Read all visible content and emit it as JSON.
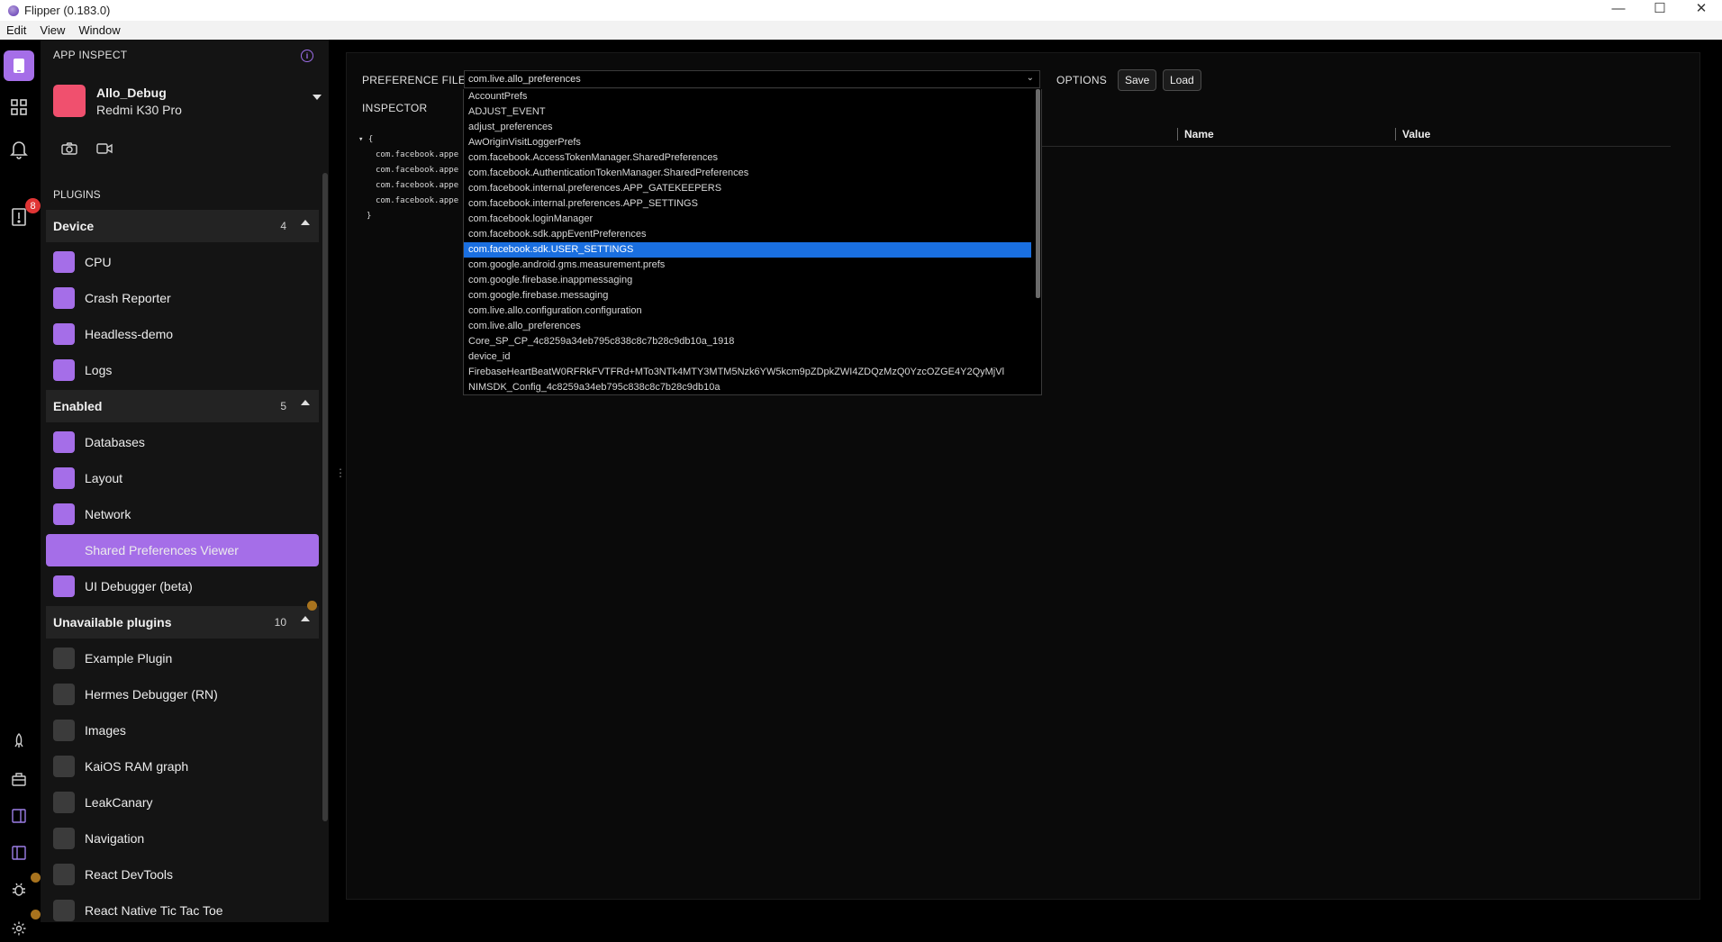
{
  "window": {
    "title": "Flipper (0.183.0)",
    "min": "—",
    "max": "☐",
    "close": "✕"
  },
  "menu": [
    "Edit",
    "View",
    "Window"
  ],
  "rail": {
    "notification_count": "8"
  },
  "sidebar": {
    "title": "APP INSPECT",
    "app_name": "Allo_Debug",
    "device_name": "Redmi K30 Pro",
    "plugins_label": "PLUGINS",
    "sections": [
      {
        "label": "Device",
        "count": "4",
        "items": [
          "CPU",
          "Crash Reporter",
          "Headless-demo",
          "Logs"
        ]
      },
      {
        "label": "Enabled",
        "count": "5",
        "items": [
          "Databases",
          "Layout",
          "Network",
          "Shared Preferences Viewer",
          "UI Debugger (beta)"
        ]
      },
      {
        "label": "Unavailable plugins",
        "count": "10",
        "items": [
          "Example Plugin",
          "Hermes Debugger (RN)",
          "Images",
          "KaiOS RAM graph",
          "LeakCanary",
          "Navigation",
          "React DevTools",
          "React Native Tic Tac Toe"
        ]
      }
    ]
  },
  "main": {
    "preference_file_label": "PREFERENCE FILE",
    "selected_file": "com.live.allo_preferences",
    "options_label": "OPTIONS",
    "save_label": "Save",
    "load_label": "Load",
    "inspector_label": "INSPECTOR",
    "tree": [
      "▾ {",
      "com.facebook.appe",
      "com.facebook.appe",
      "com.facebook.appe",
      "com.facebook.appe",
      "}"
    ],
    "columns": {
      "name": "Name",
      "value": "Value"
    }
  },
  "dropdown_options": [
    "AccountPrefs",
    "ADJUST_EVENT",
    "adjust_preferences",
    "AwOriginVisitLoggerPrefs",
    "com.facebook.AccessTokenManager.SharedPreferences",
    "com.facebook.AuthenticationTokenManager.SharedPreferences",
    "com.facebook.internal.preferences.APP_GATEKEEPERS",
    "com.facebook.internal.preferences.APP_SETTINGS",
    "com.facebook.loginManager",
    "com.facebook.sdk.appEventPreferences",
    "com.facebook.sdk.USER_SETTINGS",
    "com.google.android.gms.measurement.prefs",
    "com.google.firebase.inappmessaging",
    "com.google.firebase.messaging",
    "com.live.allo.configuration.configuration",
    "com.live.allo_preferences",
    "Core_SP_CP_4c8259a34eb795c838c8c7b28c9db10a_1918",
    "device_id",
    "FirebaseHeartBeatW0RFRkFVTFRd+MTo3NTk4MTY3MTM5Nzk6YW5kcm9pZDpkZWI4ZDQzMzQ0YzcOZGE4Y2QyMjVl",
    "NIMSDK_Config_4c8259a34eb795c838c8c7b28c9db10a"
  ],
  "highlighted_option": "com.facebook.sdk.USER_SETTINGS"
}
